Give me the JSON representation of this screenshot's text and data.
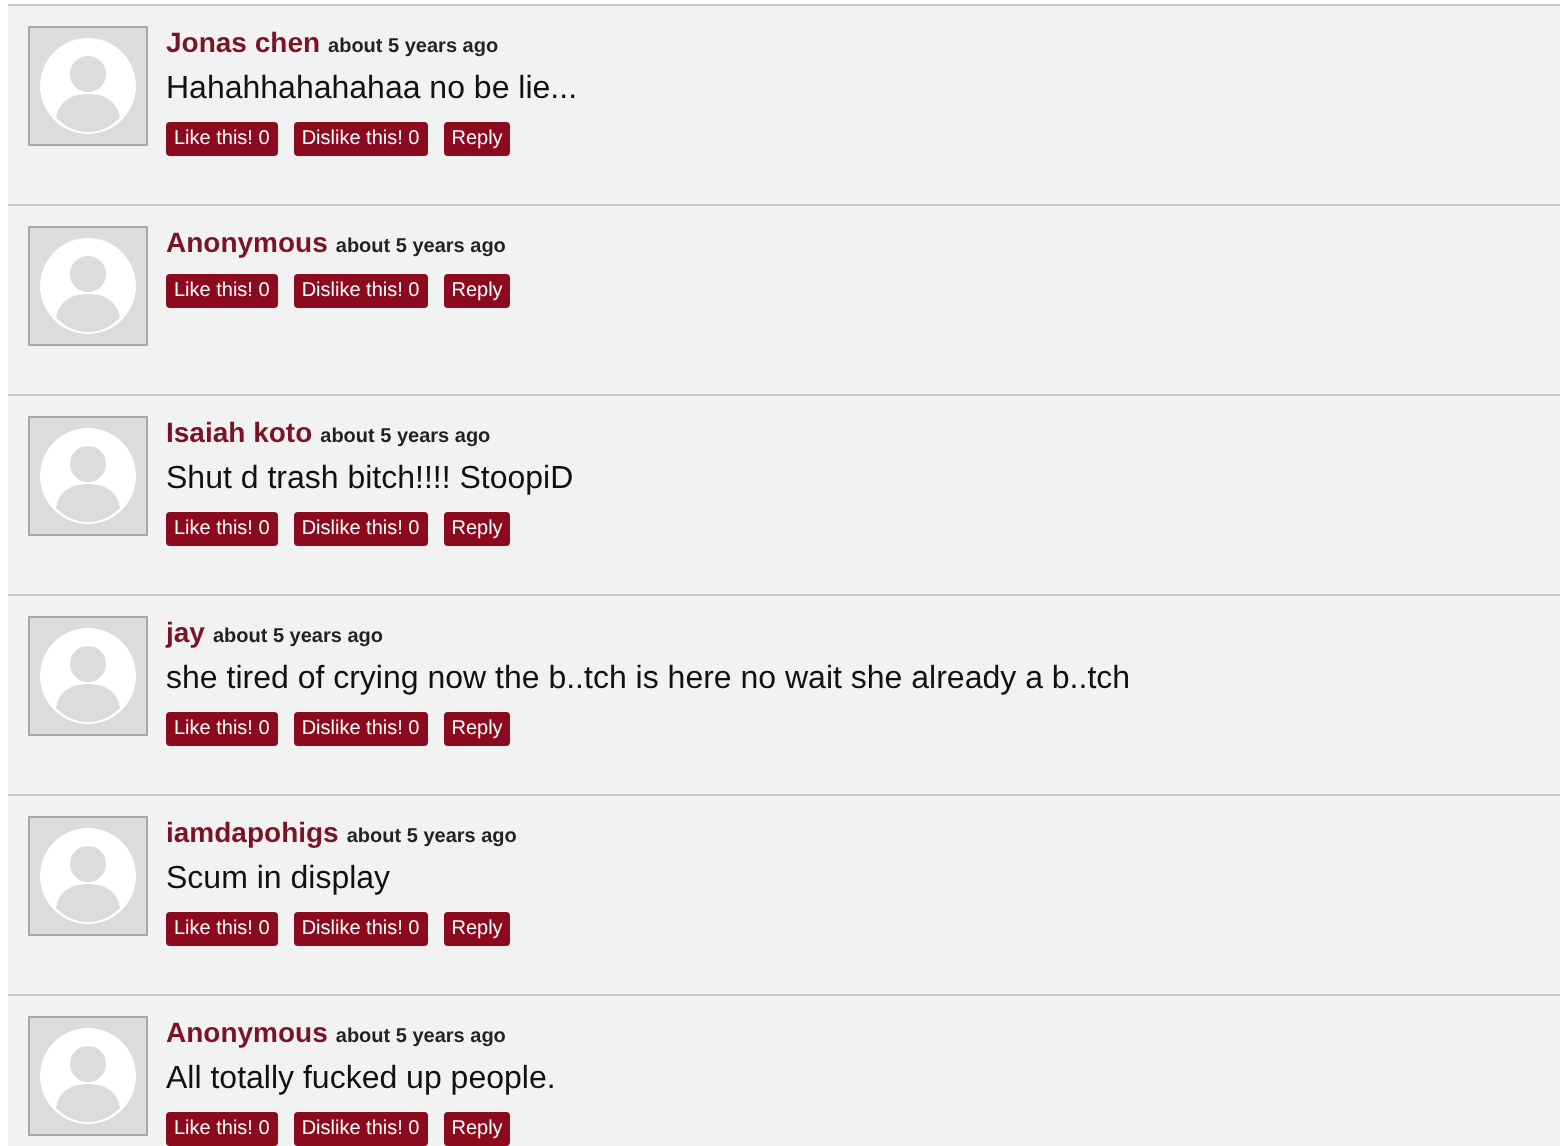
{
  "comments": [
    {
      "author": "Jonas chen",
      "time": "about 5 years ago",
      "text": "Hahahhahahahaa no be lie...",
      "like": "Like this! 0",
      "dislike": "Dislike this! 0",
      "reply": "Reply"
    },
    {
      "author": "Anonymous",
      "time": "about 5 years ago",
      "like": "Like this! 0",
      "dislike": "Dislike this! 0",
      "reply": "Reply"
    },
    {
      "author": "Isaiah koto",
      "time": "about 5 years ago",
      "text": "Shut d trash bitch!!!! StoopiD",
      "like": "Like this! 0",
      "dislike": "Dislike this! 0",
      "reply": "Reply"
    },
    {
      "author": "jay",
      "time": "about 5 years ago",
      "text": "she tired of crying now the b..tch is here no wait she already a b..tch",
      "like": "Like this! 0",
      "dislike": "Dislike this! 0",
      "reply": "Reply"
    },
    {
      "author": "iamdapohigs",
      "time": "about 5 years ago",
      "text": "Scum in display",
      "like": "Like this! 0",
      "dislike": "Dislike this! 0",
      "reply": "Reply"
    },
    {
      "author": "Anonymous",
      "time": "about 5 years ago",
      "text": "All totally fucked up people.",
      "like": "Like this! 0",
      "dislike": "Dislike this! 0",
      "reply": "Reply"
    }
  ]
}
